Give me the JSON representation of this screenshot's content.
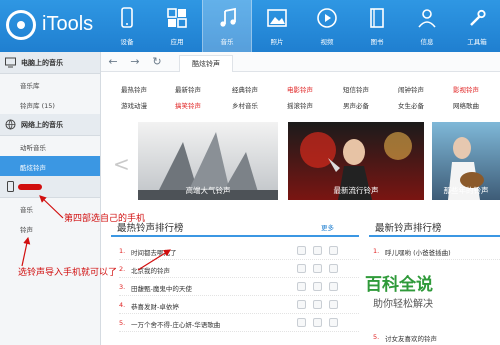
{
  "app": {
    "title": "iTools"
  },
  "nav": {
    "items": [
      {
        "label": "设备",
        "icon": "phone-icon"
      },
      {
        "label": "应用",
        "icon": "apps-icon"
      },
      {
        "label": "音乐",
        "icon": "music-note-icon",
        "active": true
      },
      {
        "label": "照片",
        "icon": "photo-icon"
      },
      {
        "label": "视频",
        "icon": "play-icon"
      },
      {
        "label": "图书",
        "icon": "book-icon"
      },
      {
        "label": "信息",
        "icon": "person-icon"
      },
      {
        "label": "工具箱",
        "icon": "toolbox-icon"
      }
    ]
  },
  "sidebar": {
    "sections": [
      {
        "title": "电脑上的音乐",
        "icon": "monitor-icon",
        "items": [
          "音乐库",
          "铃声库 (15)"
        ]
      },
      {
        "title": "网络上的音乐",
        "icon": "globe-icon",
        "items": [
          "动听音乐",
          "酷炫铃声"
        ],
        "active_item": "酷炫铃声"
      },
      {
        "title": "",
        "icon": "device-icon",
        "items": [
          "音乐",
          "铃声"
        ]
      }
    ]
  },
  "toolbar": {
    "back": "←",
    "forward": "→",
    "refresh": "↻",
    "tab": "酷炫铃声"
  },
  "categories": {
    "row1": [
      {
        "label": "最热铃声",
        "color": "dark"
      },
      {
        "label": "最新铃声",
        "color": "dark"
      },
      {
        "label": "经典铃声",
        "color": "dark"
      },
      {
        "label": "电影铃声",
        "color": "red"
      },
      {
        "label": "短信铃声",
        "color": "dark"
      },
      {
        "label": "闹钟铃声",
        "color": "dark"
      },
      {
        "label": "影视铃声",
        "color": "red"
      },
      {
        "label": "欧美铃声",
        "color": "dark"
      }
    ],
    "row2": [
      {
        "label": "游戏动漫",
        "color": "red"
      },
      {
        "label": "搞笑铃声",
        "color": "dark"
      },
      {
        "label": "乡村音乐",
        "color": "dark"
      },
      {
        "label": "摇滚铃声",
        "color": "dark"
      },
      {
        "label": "男声必备",
        "color": "dark"
      },
      {
        "label": "女生必备",
        "color": "dark"
      },
      {
        "label": "网络歌曲",
        "color": "dark"
      }
    ]
  },
  "banner": {
    "prev": "<",
    "items": [
      {
        "caption": "高端大气铃声"
      },
      {
        "caption": "最新流行铃声"
      },
      {
        "caption": "那些年的铃声"
      }
    ]
  },
  "hot": {
    "title": "最热铃声排行榜",
    "more": "更多",
    "rows": [
      {
        "num": "1.",
        "name": "时间都去哪儿了"
      },
      {
        "num": "2.",
        "name": "北京我的铃声"
      },
      {
        "num": "3.",
        "name": "田馥甄-魔鬼中的天使"
      },
      {
        "num": "4.",
        "name": "恭喜发财-卓依婷"
      },
      {
        "num": "5.",
        "name": "一万个舍不得-庄心妍-华语歌曲"
      }
    ]
  },
  "new": {
    "title": "最新铃声排行榜",
    "rows": [
      {
        "num": "1.",
        "name": "呼儿嘿哟 (小爸爸插曲)"
      },
      {
        "num": "5.",
        "name": "讨女友喜欢的铃声"
      }
    ]
  },
  "annotations": {
    "note1": "第四部选自己的手机",
    "note2": "选铃声导入手机就可以了"
  },
  "watermark": {
    "title": "百科全说",
    "subtitle": "助你轻松解决"
  },
  "colors": {
    "accent": "#2f97e3",
    "active": "#3b97e3",
    "red": "#e02020",
    "annotation": "#d10f0f"
  }
}
